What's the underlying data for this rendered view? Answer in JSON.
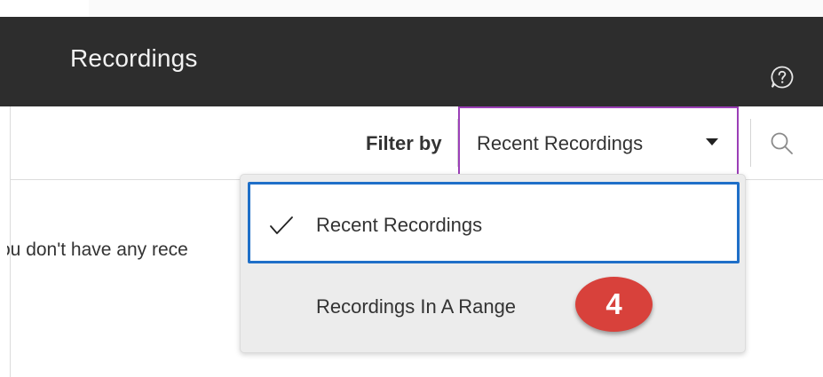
{
  "header": {
    "title": "Recordings"
  },
  "toolbar": {
    "filter_label": "Filter by",
    "filter_value": "Recent Recordings"
  },
  "main": {
    "empty_message": "ou don't have any rece"
  },
  "dropdown": {
    "options": [
      {
        "label": "Recent Recordings",
        "selected": true
      },
      {
        "label": "Recordings In A Range",
        "selected": false
      }
    ]
  },
  "annotation": {
    "step_number": "4"
  },
  "icons": {
    "help": "help-icon",
    "search": "search-icon",
    "caret": "caret-down-icon",
    "check": "checkmark-icon"
  },
  "colors": {
    "header_bg": "#2d2d2d",
    "select_border": "#9b3fb7",
    "focus_border": "#1f6fc8",
    "badge_bg": "#d8413b"
  }
}
